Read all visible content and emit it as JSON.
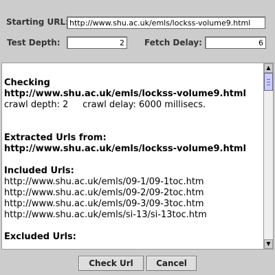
{
  "form": {
    "starting_url_label": "Starting URL:",
    "starting_url_value": "http://www.shu.ac.uk/emls/lockss-volume9.html",
    "test_depth_label": "Test Depth:",
    "test_depth_value": "2",
    "fetch_delay_label": "Fetch Delay:",
    "fetch_delay_value": "6"
  },
  "output": {
    "lines": [
      "Checking",
      "http://www.shu.ac.uk/emls/lockss-volume9.html",
      "crawl depth: 2     crawl delay: 6000 millisecs.",
      "Extracted Urls from:",
      "http://www.shu.ac.uk/emls/lockss-volume9.html",
      "Included Urls:",
      "http://www.shu.ac.uk/emls/09-1/09-1toc.htm",
      "http://www.shu.ac.uk/emls/09-2/09-2toc.htm",
      "http://www.shu.ac.uk/emls/09-3/09-3toc.htm",
      "http://www.shu.ac.uk/emls/si-13/si-13toc.htm",
      "Excluded Urls:"
    ]
  },
  "buttons": {
    "check_url_label": "Check Url",
    "cancel_label": "Cancel"
  },
  "colors": {
    "window_bg": "#cccccc",
    "thumb": "#ccccff"
  }
}
